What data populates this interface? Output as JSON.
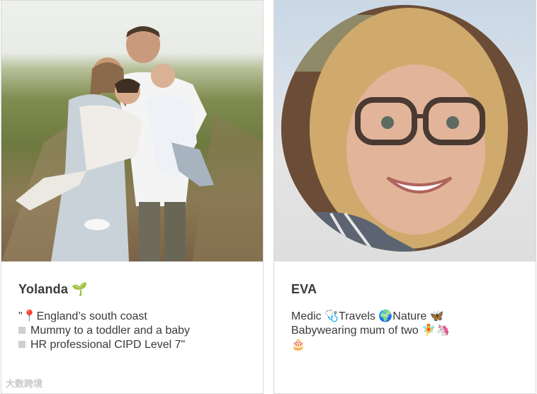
{
  "cards": [
    {
      "name": "Yolanda",
      "name_emoji": "🌱",
      "bio_lines": [
        "\"📍England’s south coast",
        "Mummy to a toddler and a baby",
        "HR professional CIPD Level 7\""
      ]
    },
    {
      "name": "EVA",
      "bio_lines": [
        "Medic 🩺Travels 🌍Nature 🦋",
        "Babywearing mum of two 🧚🦄",
        "🎂"
      ]
    }
  ],
  "watermark": "大数跨境"
}
